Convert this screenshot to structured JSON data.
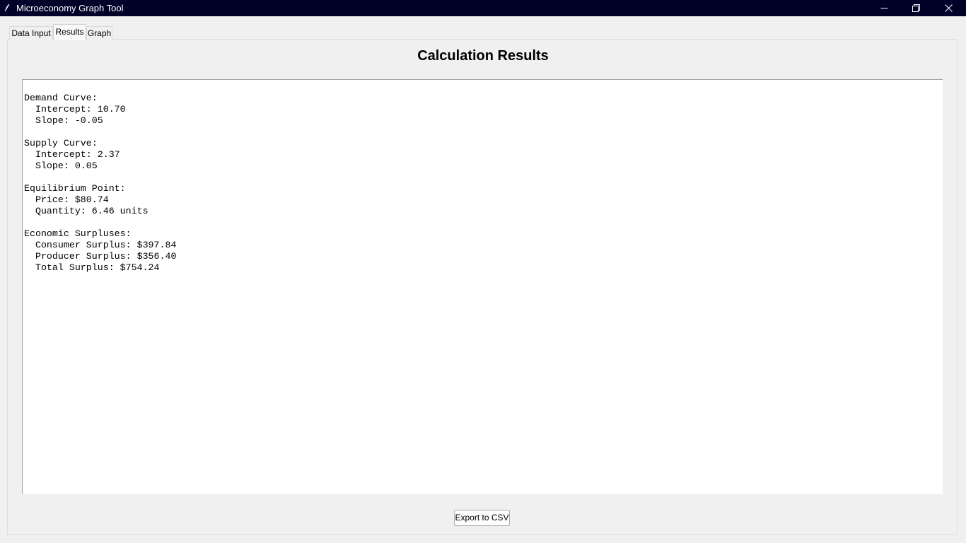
{
  "window": {
    "title": "Microeconomy Graph Tool",
    "icon": "feather-icon",
    "controls": [
      "minimize-icon",
      "restore-icon",
      "close-icon"
    ]
  },
  "tabs": [
    {
      "label": "Data Input",
      "active": false
    },
    {
      "label": "Results",
      "active": true
    },
    {
      "label": "Graph",
      "active": false
    }
  ],
  "results": {
    "heading": "Calculation Results",
    "text": "Demand Curve:\n  Intercept: 10.70\n  Slope: -0.05\n\nSupply Curve:\n  Intercept: 2.37\n  Slope: 0.05\n\nEquilibrium Point:\n  Price: $80.74\n  Quantity: 6.46 units\n\nEconomic Surpluses:\n  Consumer Surplus: $397.84\n  Producer Surplus: $356.40\n  Total Surplus: $754.24"
  },
  "actions": {
    "export_label": "Export to CSV"
  },
  "colors": {
    "titlebar": "#000028",
    "background": "#f0f0f0",
    "text_area": "#ffffff"
  }
}
